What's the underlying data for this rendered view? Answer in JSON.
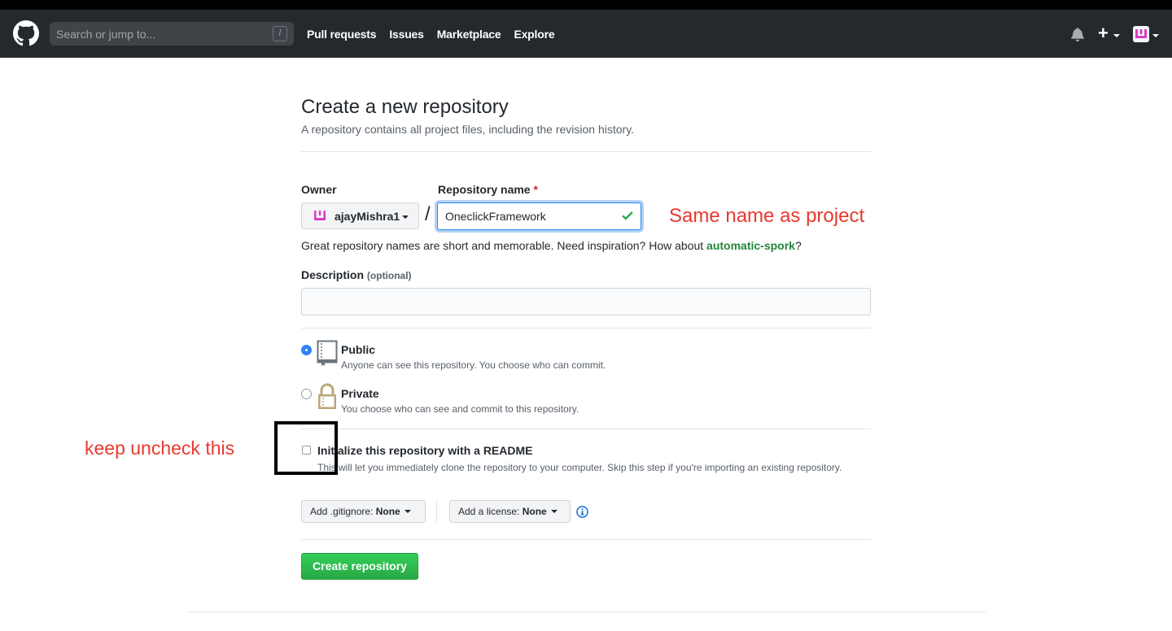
{
  "header": {
    "search_placeholder": "Search or jump to...",
    "search_shortcut": "/",
    "nav": [
      "Pull requests",
      "Issues",
      "Marketplace",
      "Explore"
    ],
    "icons": [
      "github-logo-icon",
      "bell-icon",
      "plus-icon",
      "avatar-icon"
    ]
  },
  "page": {
    "title": "Create a new repository",
    "subtitle": "A repository contains all project files, including the revision history."
  },
  "form": {
    "owner_label": "Owner",
    "owner_value": "ajayMishra1",
    "repo_label": "Repository name",
    "required_mark": "*",
    "separator": "/",
    "repo_value": "OneclickFramework",
    "hint_prefix": "Great repository names are short and memorable. Need inspiration? How about ",
    "hint_suggestion": "automatic-spork",
    "hint_suffix": "?",
    "description_label": "Description",
    "description_optional": "(optional)",
    "description_value": "",
    "visibility": [
      {
        "title": "Public",
        "desc": "Anyone can see this repository. You choose who can commit.",
        "selected": true
      },
      {
        "title": "Private",
        "desc": "You choose who can see and commit to this repository.",
        "selected": false
      }
    ],
    "readme_title": "Initialize this repository with a README",
    "readme_desc": "This will let you immediately clone the repository to your computer. Skip this step if you're importing an existing repository.",
    "readme_checked": false,
    "gitignore_label": "Add .gitignore:",
    "gitignore_value": "None",
    "license_label": "Add a license:",
    "license_value": "None",
    "create_button": "Create repository"
  },
  "annotations": {
    "repo_name_note": "Same name as project",
    "readme_note": "keep uncheck this"
  },
  "colors": {
    "header_bg": "#24292e",
    "accent_blue": "#2188ff",
    "success_green": "#28a745",
    "annotation_red": "#e8392f"
  }
}
